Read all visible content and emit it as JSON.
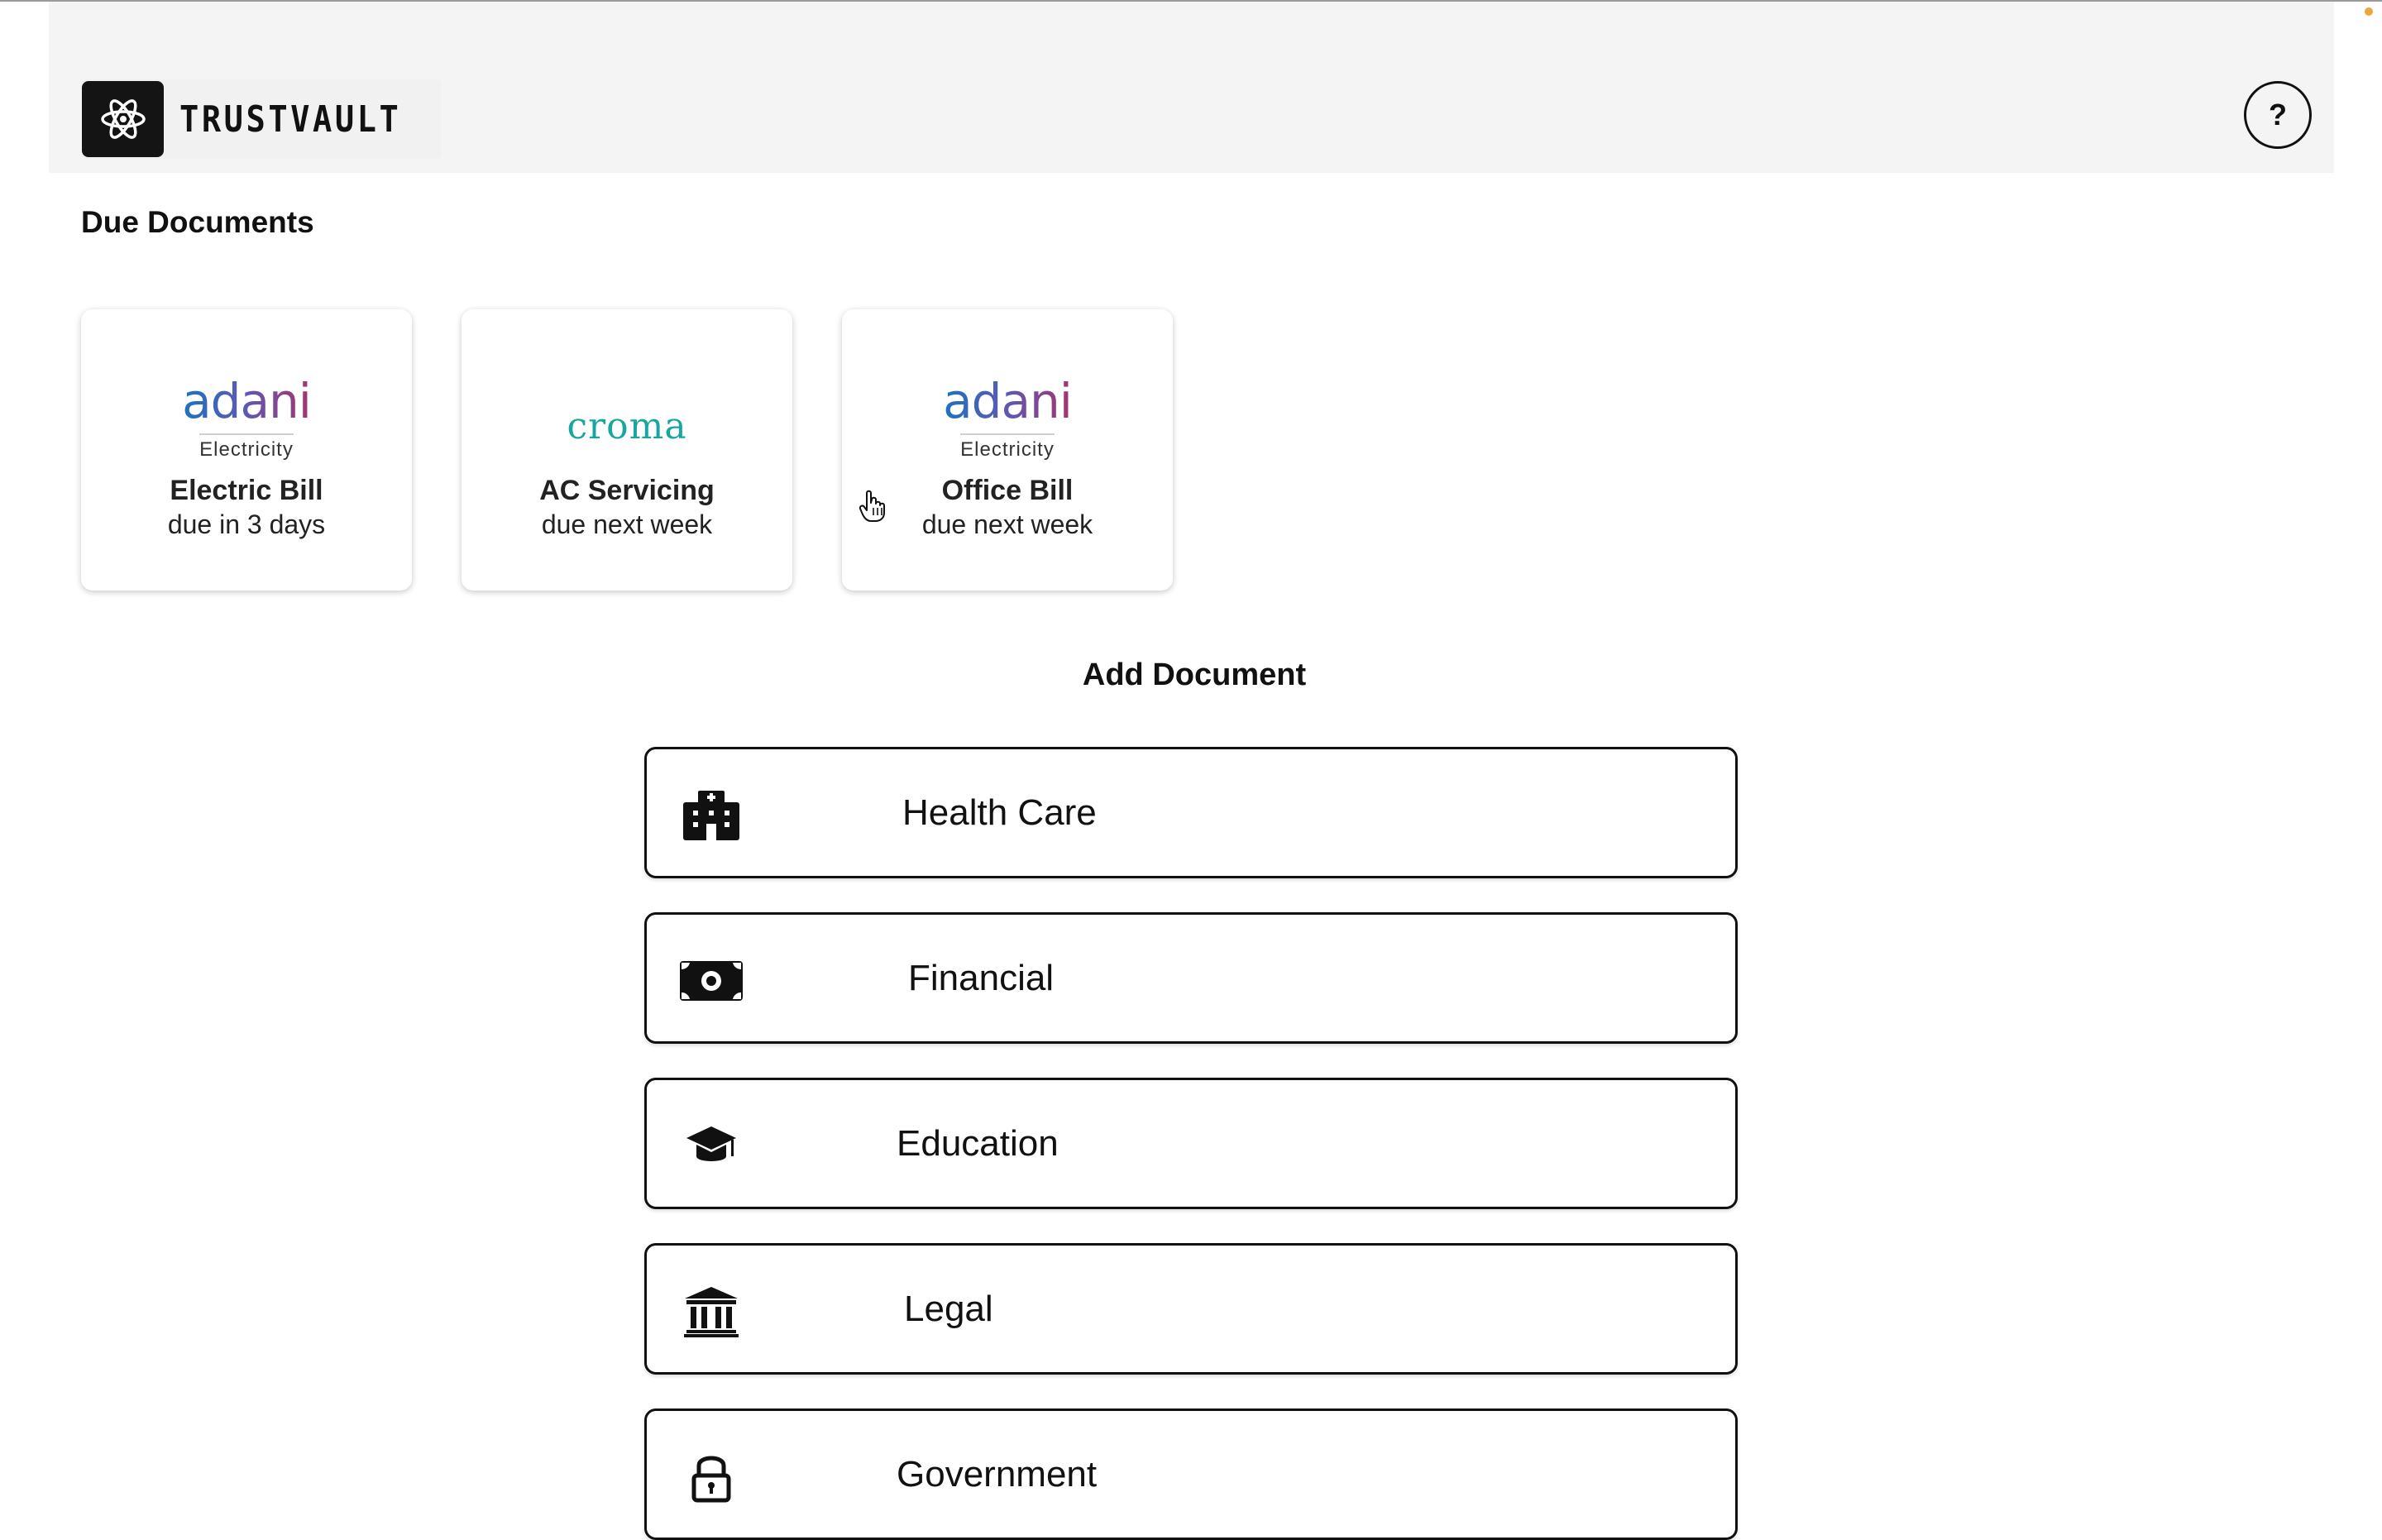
{
  "app": {
    "brand_name": "TRUSTVAULT",
    "brand_logo_icon": "atom-logo-icon",
    "help_label": "?",
    "colors": {
      "header_bg": "#f4f4f4",
      "logo_bg": "#141414",
      "adani_gradient": [
        "#1b73c2",
        "#5e58b0",
        "#a6336f"
      ],
      "croma_teal": "#1aa6a0",
      "accent_dot": "#f0a53a"
    }
  },
  "due": {
    "title": "Due Documents",
    "cards": [
      {
        "logo_word": "adani",
        "logo_sub": "Electricity",
        "title": "Electric Bill",
        "subtitle": "due in 3 days"
      },
      {
        "logo_word": "croma",
        "title": "AC Servicing",
        "subtitle": "due next week"
      },
      {
        "logo_word": "adani",
        "logo_sub": "Electricity",
        "title": "Office Bill",
        "subtitle": "due next week"
      }
    ]
  },
  "add": {
    "title": "Add Document",
    "categories": [
      {
        "label": "Health Care",
        "icon": "hospital-icon"
      },
      {
        "label": "Financial",
        "icon": "money-icon"
      },
      {
        "label": "Education",
        "icon": "graduation-cap-icon"
      },
      {
        "label": "Legal",
        "icon": "courthouse-icon"
      },
      {
        "label": "Government",
        "icon": "lock-icon"
      }
    ]
  }
}
